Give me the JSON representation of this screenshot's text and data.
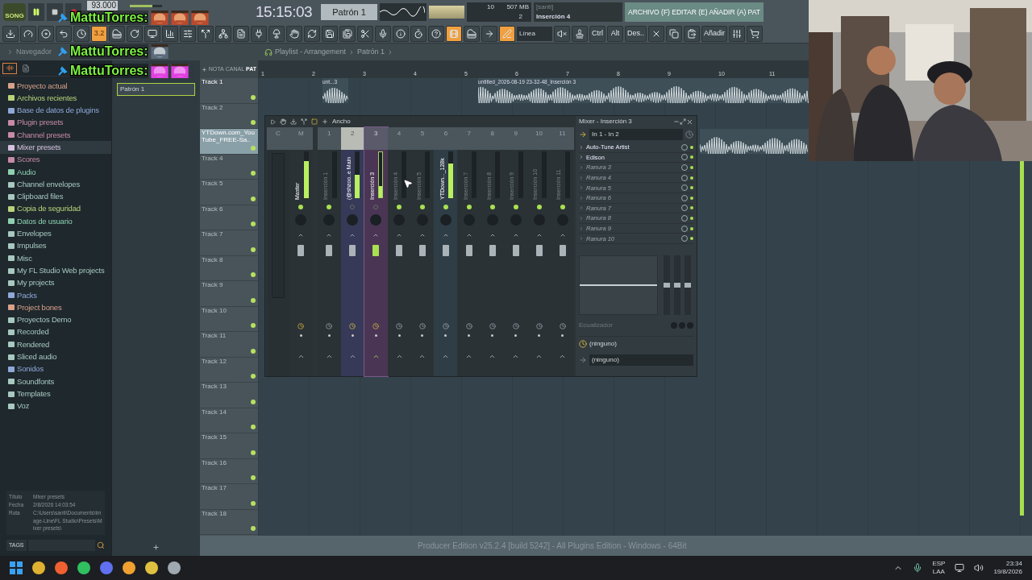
{
  "transport": {
    "mode": "SONG",
    "tempo": "93.000",
    "volume": {
      "level": 0.7
    },
    "time": "15:15:03",
    "pattern": "Patrón 1",
    "cpu": "10",
    "memory": "507 MB",
    "polyphony": "2",
    "hint_user": "[santi]",
    "hint": "Inserción 4",
    "menu": "ARCHIVO (F) EDITAR (E) AÑADIR (A) PAT"
  },
  "toolbar": [
    {
      "kind": "icon",
      "on": false
    },
    {
      "kind": "icon",
      "on": false
    },
    {
      "kind": "icon",
      "on": false
    },
    {
      "kind": "icon",
      "on": false
    },
    {
      "kind": "icon",
      "on": false
    },
    {
      "kind": "text",
      "label": "3.2",
      "on": true
    },
    {
      "kind": "icon",
      "on": false
    },
    {
      "kind": "icon",
      "on": false
    },
    {
      "kind": "icon",
      "on": false
    },
    {
      "kind": "icon",
      "on": false
    },
    {
      "kind": "icon",
      "on": false
    },
    {
      "kind": "icon",
      "on": false
    },
    {
      "kind": "icon",
      "on": false
    },
    {
      "kind": "icon",
      "on": false
    },
    {
      "kind": "icon",
      "on": false
    },
    {
      "kind": "icon",
      "on": false
    },
    {
      "kind": "icon",
      "on": false
    },
    {
      "kind": "icon",
      "on": false
    },
    {
      "kind": "icon",
      "on": false
    },
    {
      "kind": "icon",
      "on": false
    },
    {
      "kind": "icon",
      "on": false
    },
    {
      "kind": "icon",
      "on": false
    },
    {
      "kind": "icon",
      "on": false
    },
    {
      "kind": "icon",
      "on": false
    },
    {
      "kind": "icon",
      "on": false
    },
    {
      "kind": "icon",
      "on": true
    },
    {
      "kind": "icon",
      "on": false
    },
    {
      "kind": "icon",
      "on": false
    },
    {
      "kind": "icon",
      "on": true
    },
    {
      "kind": "dropdown",
      "label": "Línea",
      "on": false
    },
    {
      "kind": "icon",
      "on": false
    },
    {
      "kind": "icon",
      "on": false
    },
    {
      "kind": "text",
      "label": "Ctrl",
      "on": false
    },
    {
      "kind": "text",
      "label": "Alt",
      "on": false
    },
    {
      "kind": "text",
      "label": "Des..",
      "on": false
    },
    {
      "kind": "icon",
      "on": false
    },
    {
      "kind": "icon",
      "on": false
    },
    {
      "kind": "icon",
      "on": false
    },
    {
      "kind": "text",
      "label": "Añadir",
      "on": false
    },
    {
      "kind": "icon",
      "on": false
    },
    {
      "kind": "icon",
      "on": false
    }
  ],
  "chat": [
    {
      "user": "MattuTorres:"
    },
    {
      "user": "MattuTorres:"
    },
    {
      "user": "MattuTorres:"
    }
  ],
  "navigator": "Navegador",
  "breadcrumb": [
    "Playlist - Arrangement",
    "Patrón 1"
  ],
  "browser": {
    "items": [
      {
        "label": "Proyecto actual",
        "color": "#d9a08a",
        "selected": false
      },
      {
        "label": "Archivos recientes",
        "color": "#b8d37a",
        "selected": false
      },
      {
        "label": "Base de datos de plugins",
        "color": "#8fa8d8",
        "selected": false
      },
      {
        "label": "Plugin presets",
        "color": "#c88aa8",
        "selected": false
      },
      {
        "label": "Channel presets",
        "color": "#c88aa8",
        "selected": false
      },
      {
        "label": "Mixer presets",
        "color": "#d8c0e0",
        "selected": true
      },
      {
        "label": "Scores",
        "color": "#c88aa8",
        "selected": false
      },
      {
        "label": "Audio",
        "color": "#8fd0b0",
        "selected": false
      },
      {
        "label": "Channel envelopes",
        "color": "#a8c8c0",
        "selected": false
      },
      {
        "label": "Clipboard files",
        "color": "#a8c8c0",
        "selected": false
      },
      {
        "label": "Copia de seguridad",
        "color": "#b8d37a",
        "selected": false
      },
      {
        "label": "Datos de usuario",
        "color": "#8fd0b0",
        "selected": false
      },
      {
        "label": "Envelopes",
        "color": "#a8c8c0",
        "selected": false
      },
      {
        "label": "Impulses",
        "color": "#a8c8c0",
        "selected": false
      },
      {
        "label": "Misc",
        "color": "#a8c8c0",
        "selected": false
      },
      {
        "label": "My FL Studio Web projects",
        "color": "#a8c8c0",
        "selected": false
      },
      {
        "label": "My projects",
        "color": "#a8c8c0",
        "selected": false
      },
      {
        "label": "Packs",
        "color": "#8fa8d8",
        "selected": false
      },
      {
        "label": "Project bones",
        "color": "#d9a08a",
        "selected": false
      },
      {
        "label": "Proyectos Demo",
        "color": "#a8c8c0",
        "selected": false
      },
      {
        "label": "Recorded",
        "color": "#a8c8c0",
        "selected": false
      },
      {
        "label": "Rendered",
        "color": "#a8c8c0",
        "selected": false
      },
      {
        "label": "Sliced audio",
        "color": "#a8c8c0",
        "selected": false
      },
      {
        "label": "Sonidos",
        "color": "#8fa8d8",
        "selected": false
      },
      {
        "label": "Soundfonts",
        "color": "#a8c8c0",
        "selected": false
      },
      {
        "label": "Templates",
        "color": "#a8c8c0",
        "selected": false
      },
      {
        "label": "Voz",
        "color": "#a8c8c0",
        "selected": false
      }
    ],
    "info": [
      {
        "key": "Título",
        "value": "Mixer presets"
      },
      {
        "key": "Fecha",
        "value": "2/8/2026 14:03:54"
      },
      {
        "key": "Ruta",
        "value": "C:\\Users\\santi\\Documents\\Image-Line\\FL Studio\\Presets\\Mixer presets\\"
      }
    ],
    "tags": "TAGS"
  },
  "patterns": [
    {
      "label": "Patrón 1",
      "selected": true
    }
  ],
  "playlist": {
    "tabs": [
      {
        "label": "NOTA",
        "selected": false
      },
      {
        "label": "CANAL",
        "selected": false
      },
      {
        "label": "PAT",
        "selected": true
      }
    ],
    "ruler": [
      "1",
      "2",
      "3",
      "4",
      "5",
      "6",
      "7",
      "8",
      "9",
      "10",
      "11"
    ],
    "tracks": [
      {
        "name": "Track 1",
        "selected": false
      },
      {
        "name": "Track 2",
        "selected": false
      },
      {
        "name": "YTDown.com_YouTube_FREE-Sa..",
        "selected": true
      },
      {
        "name": "Track 4",
        "selected": false
      },
      {
        "name": "Track 5",
        "selected": false
      },
      {
        "name": "Track 6",
        "selected": false
      },
      {
        "name": "Track 7",
        "selected": false
      },
      {
        "name": "Track 8",
        "selected": false
      },
      {
        "name": "Track 9",
        "selected": false
      },
      {
        "name": "Track 10",
        "selected": false
      },
      {
        "name": "Track 11",
        "selected": false
      },
      {
        "name": "Track 12",
        "selected": false
      },
      {
        "name": "Track 13",
        "selected": false
      },
      {
        "name": "Track 14",
        "selected": false
      },
      {
        "name": "Track 15",
        "selected": false
      },
      {
        "name": "Track 16",
        "selected": false
      },
      {
        "name": "Track 17",
        "selected": false
      },
      {
        "name": "Track 18",
        "selected": false
      }
    ],
    "clips": [
      {
        "label": "unt...3"
      },
      {
        "label": "untitled_2026-08-19 23-32-48_Inserción 3"
      },
      {
        "kind": "audio"
      }
    ]
  },
  "mixer": {
    "title": "Mixer - Inserción 3",
    "width_mode": "Ancho",
    "cue_label": "C",
    "strips": [
      {
        "number": "M",
        "name": "Master",
        "level": 0.8,
        "selected": false,
        "color": "#2b3236"
      },
      {
        "number": "1",
        "name": "Inserción 1",
        "level": 0,
        "selected": false,
        "color": "#2b3236"
      },
      {
        "number": "2",
        "name": "(@shzoo..e Main",
        "level": 0.5,
        "selected": false,
        "color": "#363a58"
      },
      {
        "number": "3",
        "name": "Inserción 3",
        "level": 0.25,
        "selected": true,
        "color": "#4a3654"
      },
      {
        "number": "4",
        "name": "Inserción 4",
        "level": 0,
        "selected": false,
        "color": "#2b3236"
      },
      {
        "number": "5",
        "name": "Inserción 5",
        "level": 0,
        "selected": false,
        "color": "#2b3236"
      },
      {
        "number": "6",
        "name": "YTDown..._128k",
        "level": 0.75,
        "selected": false,
        "color": "#2f3e46"
      },
      {
        "number": "7",
        "name": "Inserción 7",
        "level": 0,
        "selected": false,
        "color": "#2b3236"
      },
      {
        "number": "8",
        "name": "Inserción 8",
        "level": 0,
        "selected": false,
        "color": "#2b3236"
      },
      {
        "number": "9",
        "name": "Inserción 9",
        "level": 0,
        "selected": false,
        "color": "#2b3236"
      },
      {
        "number": "10",
        "name": "Inserción 10",
        "level": 0,
        "selected": false,
        "color": "#2b3236"
      },
      {
        "number": "11",
        "name": "Inserción 11",
        "level": 0,
        "selected": false,
        "color": "#2b3236"
      }
    ],
    "input": "In 1 - In 2",
    "slots": [
      {
        "label": "Auto-Tune Artist",
        "empty": false
      },
      {
        "label": "Edison",
        "empty": false
      },
      {
        "label": "Ranura 3",
        "empty": true
      },
      {
        "label": "Ranura 4",
        "empty": true
      },
      {
        "label": "Ranura 5",
        "empty": true
      },
      {
        "label": "Ranura 6",
        "empty": true
      },
      {
        "label": "Ranura 7",
        "empty": true
      },
      {
        "label": "Ranura 8",
        "empty": true
      },
      {
        "label": "Ranura 9",
        "empty": true
      },
      {
        "label": "Ranura 10",
        "empty": true
      }
    ],
    "eq": "Ecualizador",
    "send": "(ninguno)",
    "output": "(ninguno)"
  },
  "status": "Producer Edition v25.2.4 [build 5242] - All Plugins Edition - Windows - 64Bit",
  "taskbar": {
    "lang": "ESP",
    "layout": "LAA",
    "time": "23:34",
    "date": "19/8/2026"
  }
}
